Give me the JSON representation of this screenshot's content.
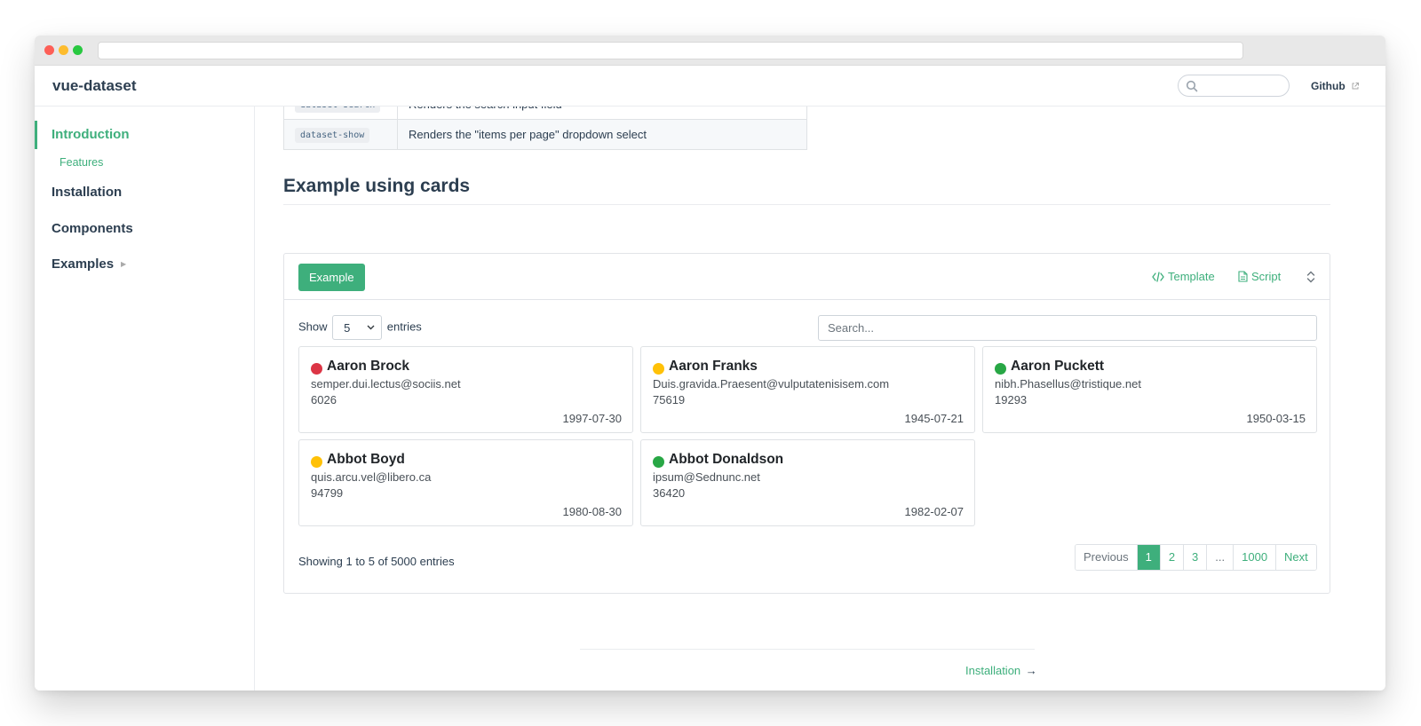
{
  "navbar": {
    "brand": "vue-dataset",
    "github_label": "Github"
  },
  "sidebar": {
    "active_item": "Introduction",
    "sub_item": "Features",
    "items": [
      "Installation",
      "Components",
      "Examples"
    ]
  },
  "props_table": {
    "rows": [
      {
        "name": "dataset-search",
        "description": "Renders the search input field"
      },
      {
        "name": "dataset-show",
        "description": "Renders the \"items per page\" dropdown select"
      }
    ]
  },
  "section": {
    "title": "Example using cards"
  },
  "demo": {
    "example_label": "Example",
    "template_label": "Template",
    "script_label": "Script",
    "show_label": "Show",
    "entries_label": "entries",
    "show_value": "5",
    "search_placeholder": "Search...",
    "cards": [
      {
        "name": "Aaron Brock",
        "email": "semper.dui.lectus@sociis.net",
        "number": "6026",
        "date": "1997-07-30",
        "status_color": "#dc3545"
      },
      {
        "name": "Aaron Franks",
        "email": "Duis.gravida.Praesent@vulputatenisisem.com",
        "number": "75619",
        "date": "1945-07-21",
        "status_color": "#ffc107"
      },
      {
        "name": "Aaron Puckett",
        "email": "nibh.Phasellus@tristique.net",
        "number": "19293",
        "date": "1950-03-15",
        "status_color": "#28a745"
      },
      {
        "name": "Abbot Boyd",
        "email": "quis.arcu.vel@libero.ca",
        "number": "94799",
        "date": "1980-08-30",
        "status_color": "#ffc107"
      },
      {
        "name": "Abbot Donaldson",
        "email": "ipsum@Sednunc.net",
        "number": "36420",
        "date": "1982-02-07",
        "status_color": "#28a745"
      }
    ],
    "showing_text": "Showing 1 to 5 of 5000 entries",
    "pagination": {
      "previous": "Previous",
      "pages": [
        "1",
        "2",
        "3",
        "...",
        "1000"
      ],
      "next": "Next",
      "active_page": "1"
    }
  },
  "footer": {
    "next_label": "Installation",
    "next_arrow": "→"
  },
  "colors": {
    "accent": "#3eaf7c",
    "text": "#2c3e50"
  }
}
